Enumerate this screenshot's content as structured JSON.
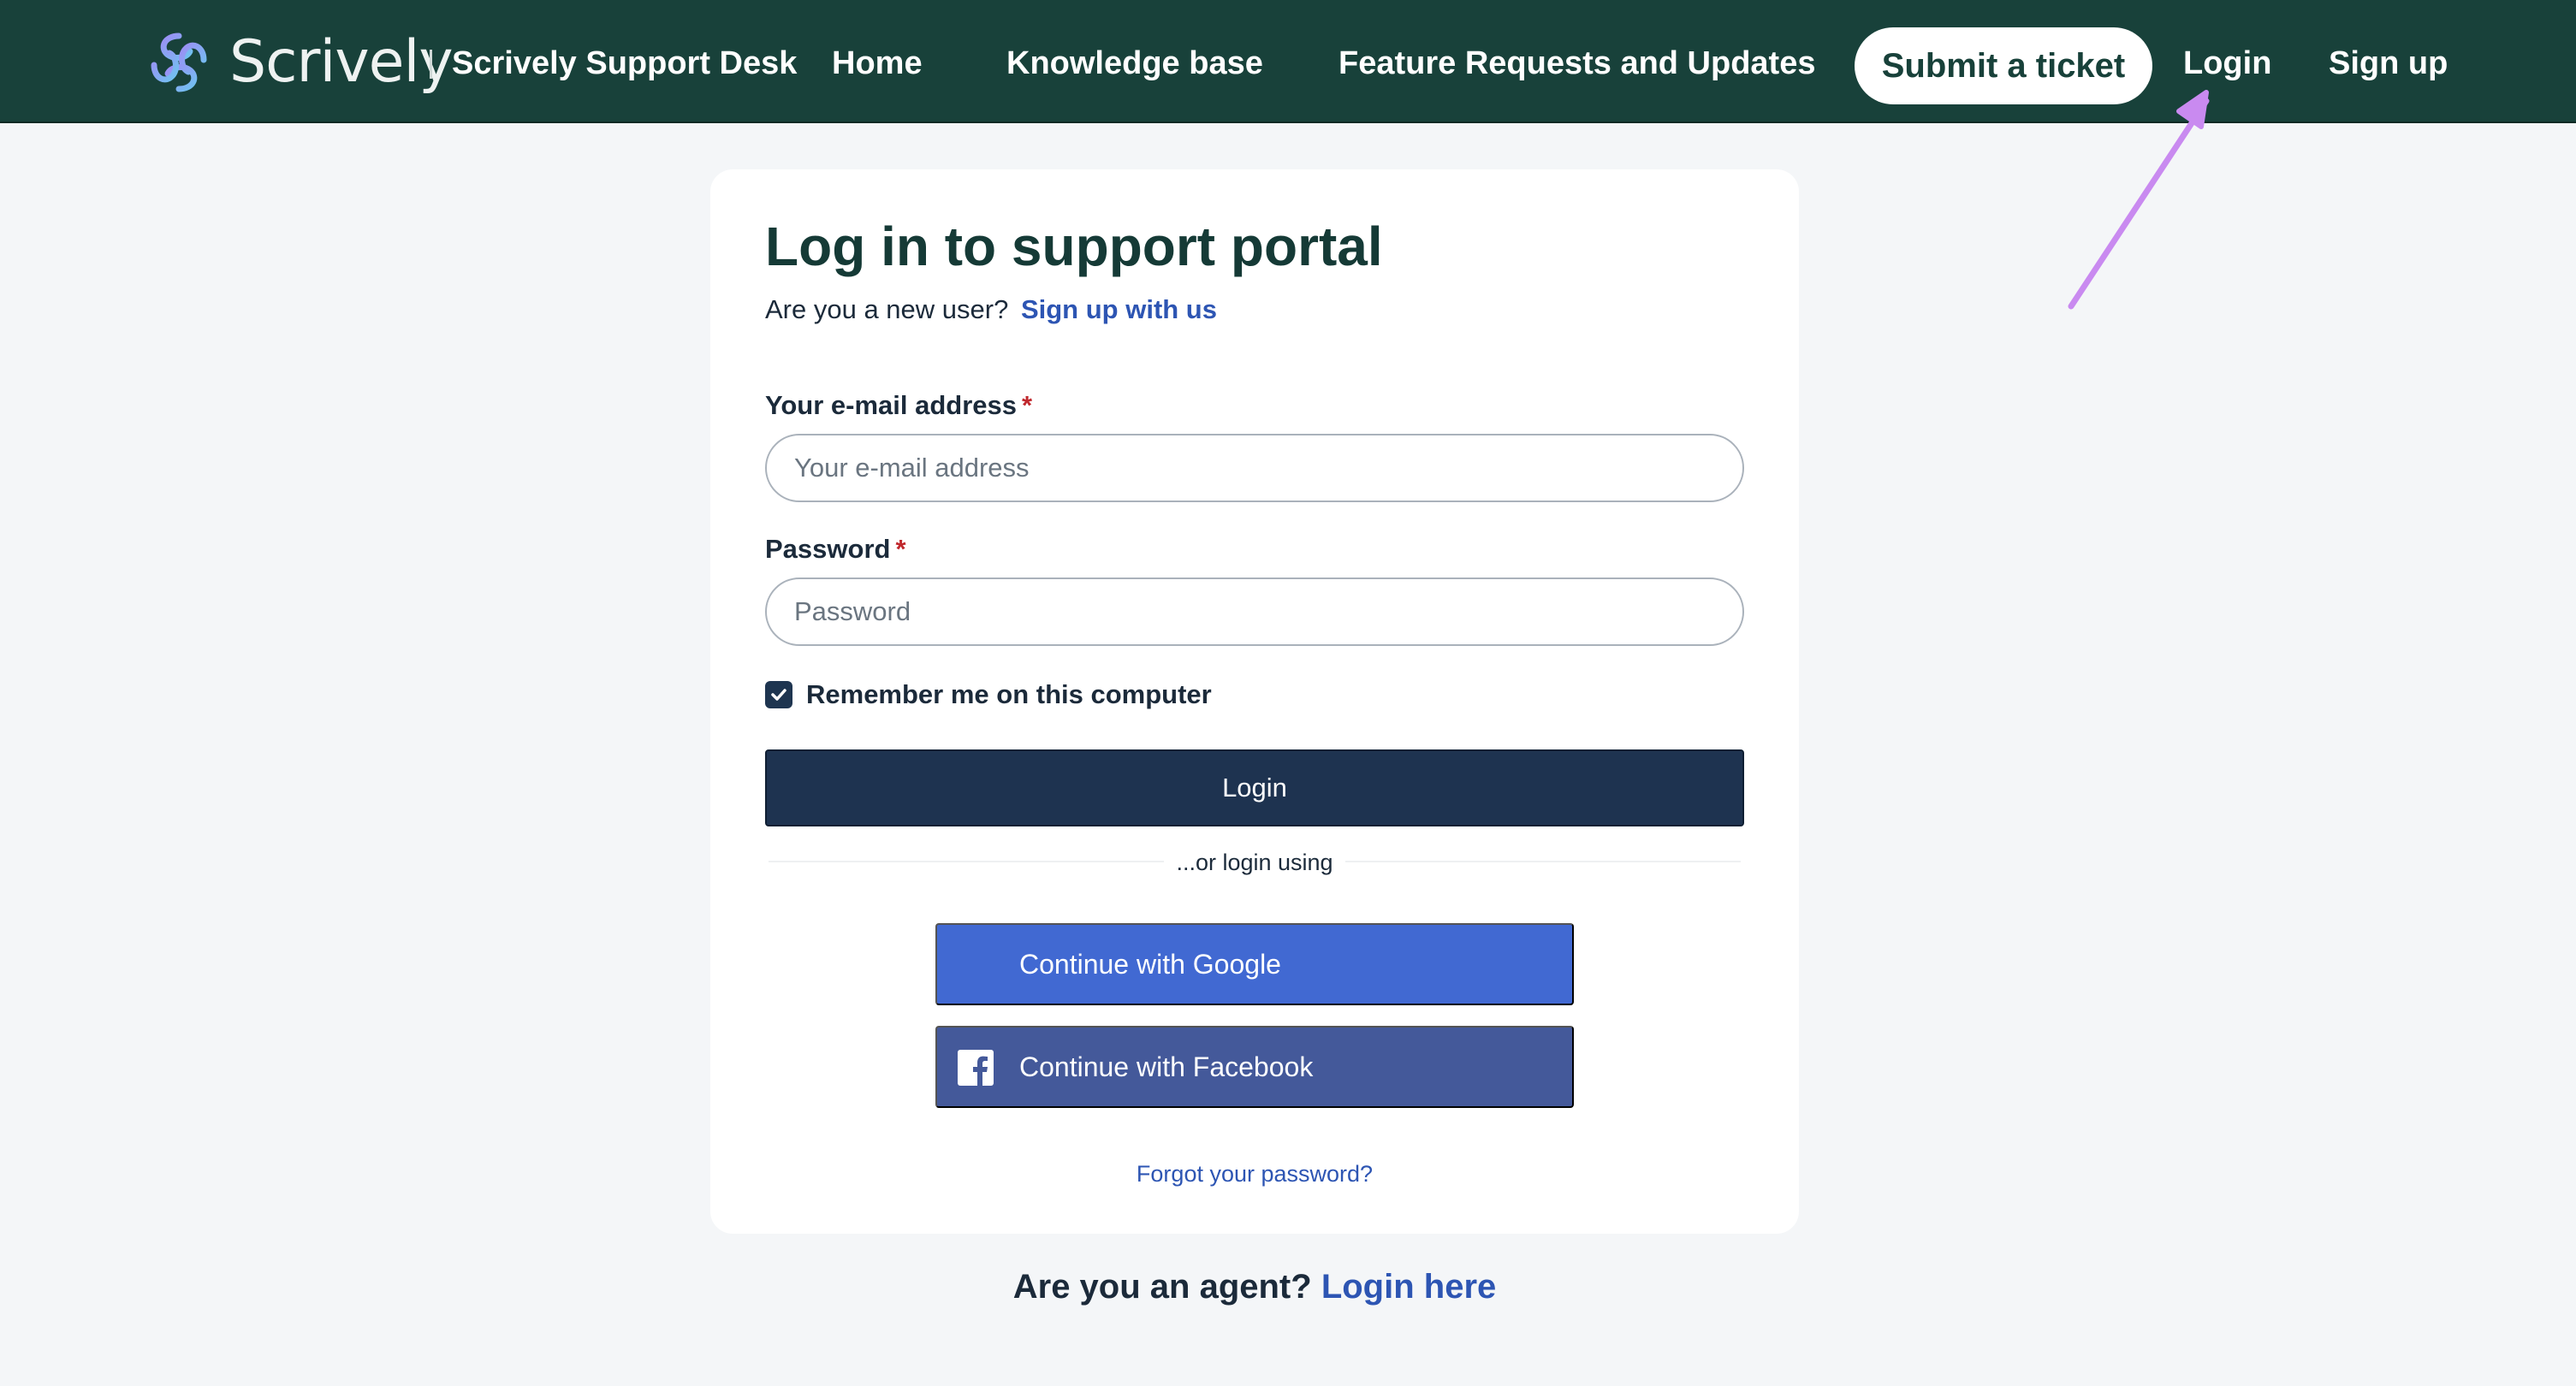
{
  "header": {
    "logo_text": "Scrively",
    "brand_title": "Scrively Support Desk",
    "nav": {
      "home": "Home",
      "knowledge_base": "Knowledge base",
      "feature_requests": "Feature Requests and Updates",
      "submit_ticket": "Submit a ticket",
      "login": "Login",
      "signup": "Sign up"
    }
  },
  "login_form": {
    "title": "Log in to support portal",
    "new_user_prompt": "Are you a new user?",
    "signup_link": "Sign up with us",
    "email": {
      "label": "Your e-mail address",
      "required_mark": "*",
      "placeholder": "Your e-mail address",
      "value": ""
    },
    "password": {
      "label": "Password",
      "required_mark": "*",
      "placeholder": "Password",
      "value": ""
    },
    "remember_me": {
      "label": "Remember me on this computer",
      "checked": true
    },
    "login_button": "Login",
    "divider_text": "...or login using",
    "google_button": "Continue with Google",
    "facebook_button": "Continue with Facebook",
    "forgot_password": "Forgot your password?"
  },
  "agent": {
    "prompt": "Are you an agent?",
    "link": "Login here"
  },
  "icons": {
    "logo": "scrively-swirl-logo-icon",
    "checkbox": "check-icon",
    "facebook": "facebook-icon",
    "annotation": "arrow-annotation-icon"
  },
  "colors": {
    "header_bg": "#18413a",
    "primary_button": "#1e3350",
    "google_blue": "#4169d2",
    "facebook_blue": "#44599a",
    "link_blue": "#2d55b3",
    "required_red": "#c0282d",
    "annotation_purple": "#c98af0"
  }
}
